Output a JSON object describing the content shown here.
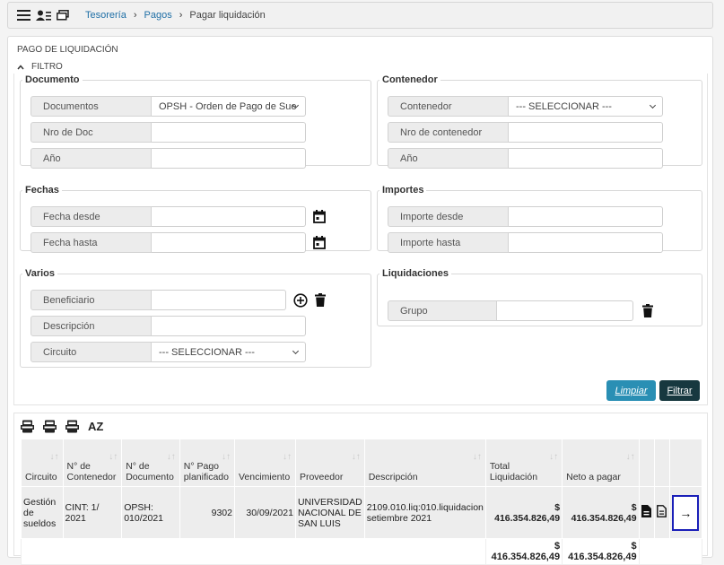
{
  "breadcrumb": {
    "items": [
      "Tesorería",
      "Pagos"
    ],
    "current": "Pagar liquidación"
  },
  "panel": {
    "title": "PAGO DE LIQUIDACIÓN",
    "filter_title": "FILTRO"
  },
  "documento": {
    "legend": "Documento",
    "documentos_label": "Documentos",
    "documentos_value": "OPSH - Orden de Pago de Sue",
    "nro_doc_label": "Nro de Doc",
    "anio_label": "Año"
  },
  "contenedor": {
    "legend": "Contenedor",
    "contenedor_label": "Contenedor",
    "contenedor_value": "--- SELECCIONAR ---",
    "nro_contenedor_label": "Nro de contenedor",
    "anio_label": "Año"
  },
  "fechas": {
    "legend": "Fechas",
    "desde_label": "Fecha desde",
    "hasta_label": "Fecha hasta"
  },
  "importes": {
    "legend": "Importes",
    "desde_label": "Importe desde",
    "hasta_label": "Importe hasta"
  },
  "varios": {
    "legend": "Varios",
    "beneficiario_label": "Beneficiario",
    "descripcion_label": "Descripción",
    "circuito_label": "Circuito",
    "circuito_value": "--- SELECCIONAR ---"
  },
  "liquidaciones": {
    "legend": "Liquidaciones",
    "grupo_label": "Grupo"
  },
  "buttons": {
    "limpiar": "Limpiar",
    "filtrar": "Filtrar"
  },
  "export": {
    "az_label": "AZ"
  },
  "table": {
    "headers": {
      "circuito": "Circuito",
      "contenedor": "N° de Contenedor",
      "documento": "N° de Documento",
      "pago": "N° Pago planificado",
      "vencimiento": "Vencimiento",
      "proveedor": "Proveedor",
      "descripcion": "Descripción",
      "total": "Total Liquidación",
      "neto": "Neto a pagar"
    },
    "row": {
      "circuito": "Gestión de sueldos",
      "contenedor": "CINT: 1/ 2021",
      "documento": "OPSH: 010/2021",
      "pago": "9302",
      "vencimiento": "30/09/2021",
      "proveedor": "UNIVERSIDAD NACIONAL DE SAN LUIS",
      "descripcion": "2109.010.liq:010.liquidacion setiembre 2021",
      "total": "$ 416.354.826,49",
      "neto": "$ 416.354.826,49"
    },
    "totals": {
      "total": "$ 416.354.826,49",
      "neto": "$ 416.354.826,49"
    }
  },
  "colors": {
    "link": "#1f6fa6",
    "limpiar": "#2a8fb4",
    "filtrar": "#17383f",
    "highlight": "#1a1fb8"
  }
}
